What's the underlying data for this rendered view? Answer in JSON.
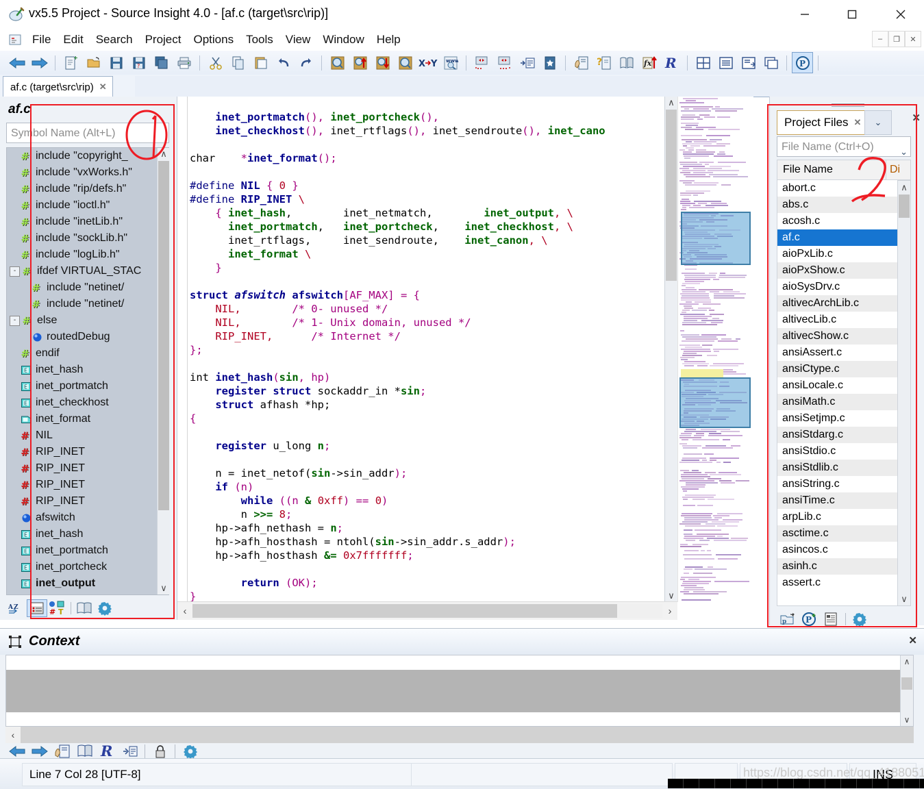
{
  "window": {
    "title": "vx5.5 Project - Source Insight 4.0 - [af.c (target\\src\\rip)]",
    "icon": "source-insight-icon",
    "minimize": "—",
    "maximize": "□",
    "close": "✕",
    "mdi_minimize": "–",
    "mdi_restore": "❐",
    "mdi_close": "✕"
  },
  "menu": {
    "items": [
      "File",
      "Edit",
      "Search",
      "Project",
      "Options",
      "Tools",
      "View",
      "Window",
      "Help"
    ]
  },
  "toolbar": {
    "groups": [
      [
        "back-arrow-icon",
        "forward-arrow-icon"
      ],
      [
        "new-file-icon",
        "open-folder-icon",
        "save-icon",
        "save-as-icon",
        "save-all-icon",
        "print-icon"
      ],
      [
        "cut-icon",
        "copy-icon",
        "paste-icon",
        "undo-icon",
        "redo-icon"
      ],
      [
        "search-icon",
        "search-up-icon",
        "search-down-icon",
        "search-files-icon",
        "replace-icon",
        "search-web-icon"
      ],
      [
        "indent-left-icon",
        "indent-right-icon",
        "format-list-icon",
        "bookmark-icon"
      ],
      [
        "clip-window-icon",
        "symbol-info-icon",
        "reference-icon",
        "function-jump-icon",
        "relation-window-icon"
      ],
      [
        "tile-icon",
        "window-list-icon",
        "panel-icon",
        "cascade-icon"
      ],
      [
        "project-icon"
      ]
    ]
  },
  "document_tab": {
    "label": "af.c (target\\src\\rip)",
    "close": "✕"
  },
  "symbol_panel": {
    "title": "af.c",
    "search_placeholder": "Symbol Name (Alt+L)",
    "search_value": "",
    "scroll_up": "∧",
    "scroll_down": "∨",
    "items": [
      {
        "label": "include \"copyright_",
        "icon": "preprocessor-green-icon",
        "indent": 1,
        "expander": "",
        "bold": false
      },
      {
        "label": "include \"vxWorks.h\"",
        "icon": "preprocessor-green-icon",
        "indent": 1,
        "expander": "",
        "bold": false
      },
      {
        "label": "include \"rip/defs.h\"",
        "icon": "preprocessor-green-icon",
        "indent": 1,
        "expander": "",
        "bold": false
      },
      {
        "label": "include \"ioctl.h\"",
        "icon": "preprocessor-green-icon",
        "indent": 1,
        "expander": "",
        "bold": false
      },
      {
        "label": "include \"inetLib.h\"",
        "icon": "preprocessor-green-icon",
        "indent": 1,
        "expander": "",
        "bold": false
      },
      {
        "label": "include \"sockLib.h\"",
        "icon": "preprocessor-green-icon",
        "indent": 1,
        "expander": "",
        "bold": false
      },
      {
        "label": "include \"logLib.h\"",
        "icon": "preprocessor-green-icon",
        "indent": 1,
        "expander": "",
        "bold": false
      },
      {
        "label": "ifdef VIRTUAL_STAC",
        "icon": "preprocessor-green-icon",
        "indent": 1,
        "expander": "-",
        "bold": false
      },
      {
        "label": "include \"netinet/",
        "icon": "preprocessor-green-icon",
        "indent": 2,
        "expander": "",
        "bold": false
      },
      {
        "label": "include \"netinet/",
        "icon": "preprocessor-green-icon",
        "indent": 2,
        "expander": "",
        "bold": false
      },
      {
        "label": "else",
        "icon": "preprocessor-green-icon",
        "indent": 1,
        "expander": "-",
        "bold": false
      },
      {
        "label": "routedDebug",
        "icon": "variable-blue-icon",
        "indent": 2,
        "expander": "",
        "bold": false
      },
      {
        "label": "endif",
        "icon": "preprocessor-green-icon",
        "indent": 1,
        "expander": "",
        "bold": false
      },
      {
        "label": "inet_hash",
        "icon": "function-decl-icon",
        "indent": 1,
        "expander": "",
        "bold": false
      },
      {
        "label": "inet_portmatch",
        "icon": "function-decl-icon",
        "indent": 1,
        "expander": "",
        "bold": false
      },
      {
        "label": "inet_checkhost",
        "icon": "function-decl-icon",
        "indent": 1,
        "expander": "",
        "bold": false
      },
      {
        "label": "inet_format",
        "icon": "function-proto-icon",
        "indent": 1,
        "expander": "",
        "bold": false
      },
      {
        "label": "NIL",
        "icon": "preprocessor-red-icon",
        "indent": 1,
        "expander": "",
        "bold": false
      },
      {
        "label": "RIP_INET",
        "icon": "preprocessor-red-icon",
        "indent": 1,
        "expander": "",
        "bold": false
      },
      {
        "label": "RIP_INET",
        "icon": "preprocessor-red-icon",
        "indent": 1,
        "expander": "",
        "bold": false
      },
      {
        "label": "RIP_INET",
        "icon": "preprocessor-red-icon",
        "indent": 1,
        "expander": "",
        "bold": false
      },
      {
        "label": "RIP_INET",
        "icon": "preprocessor-red-icon",
        "indent": 1,
        "expander": "",
        "bold": false
      },
      {
        "label": "afswitch",
        "icon": "variable-blue-icon",
        "indent": 1,
        "expander": "",
        "bold": false
      },
      {
        "label": "inet_hash",
        "icon": "function-decl-icon",
        "indent": 1,
        "expander": "",
        "bold": false
      },
      {
        "label": "inet_portmatch",
        "icon": "function-decl-icon",
        "indent": 1,
        "expander": "",
        "bold": false
      },
      {
        "label": "inet_portcheck",
        "icon": "function-decl-icon",
        "indent": 1,
        "expander": "",
        "bold": false
      },
      {
        "label": "inet_output",
        "icon": "function-decl-icon",
        "indent": 1,
        "expander": "",
        "bold": true
      }
    ],
    "toolbar_icons": [
      "sort-alpha-icon",
      "symbol-list-icon",
      "symbol-filter-icon",
      "browse-icon",
      "options-gear-icon"
    ]
  },
  "editor": {
    "lines": [
      [
        {
          "t": "    ",
          "c": "idp"
        },
        {
          "t": "inet_portmatch",
          "c": "fn"
        },
        {
          "t": "(),",
          "c": "pn"
        },
        {
          "t": " ",
          "c": "idp"
        },
        {
          "t": "inet_portcheck",
          "c": "id"
        },
        {
          "t": "(),",
          "c": "pn"
        }
      ],
      [
        {
          "t": "    ",
          "c": "idp"
        },
        {
          "t": "inet_checkhost",
          "c": "fn"
        },
        {
          "t": "(),",
          "c": "pn"
        },
        {
          "t": " inet_rtflags",
          "c": "idp"
        },
        {
          "t": "(),",
          "c": "pn"
        },
        {
          "t": " inet_sendroute",
          "c": "idp"
        },
        {
          "t": "(),",
          "c": "pn"
        },
        {
          "t": " ",
          "c": "idp"
        },
        {
          "t": "inet_cano",
          "c": "id"
        }
      ],
      [],
      [
        {
          "t": "char    ",
          "c": "idp"
        },
        {
          "t": "*",
          "c": "pn"
        },
        {
          "t": "inet_format",
          "c": "fn"
        },
        {
          "t": "();",
          "c": "pn"
        }
      ],
      [],
      [
        {
          "t": "#define ",
          "c": "pp"
        },
        {
          "t": "NIL",
          "c": "k"
        },
        {
          "t": " { ",
          "c": "pn"
        },
        {
          "t": "0",
          "c": "st"
        },
        {
          "t": " }",
          "c": "pn"
        }
      ],
      [
        {
          "t": "#define ",
          "c": "pp"
        },
        {
          "t": "RIP_INET",
          "c": "k"
        },
        {
          "t": " \\",
          "c": "mac"
        }
      ],
      [
        {
          "t": "    { ",
          "c": "pn"
        },
        {
          "t": "inet_hash",
          "c": "id"
        },
        {
          "t": ",        ",
          "c": "idp"
        },
        {
          "t": "inet_netmatch",
          "c": "idp"
        },
        {
          "t": ",        ",
          "c": "idp"
        },
        {
          "t": "inet_output",
          "c": "id"
        },
        {
          "t": ", \\",
          "c": "mac"
        }
      ],
      [
        {
          "t": "      ",
          "c": "idp"
        },
        {
          "t": "inet_portmatch",
          "c": "id"
        },
        {
          "t": ",   ",
          "c": "idp"
        },
        {
          "t": "inet_portcheck",
          "c": "id"
        },
        {
          "t": ",    ",
          "c": "idp"
        },
        {
          "t": "inet_checkhost",
          "c": "id"
        },
        {
          "t": ", \\",
          "c": "mac"
        }
      ],
      [
        {
          "t": "      inet_rtflags,     inet_sendroute,    ",
          "c": "idp"
        },
        {
          "t": "inet_canon",
          "c": "id"
        },
        {
          "t": ", \\",
          "c": "mac"
        }
      ],
      [
        {
          "t": "      ",
          "c": "idp"
        },
        {
          "t": "inet_format",
          "c": "id"
        },
        {
          "t": " \\",
          "c": "mac"
        }
      ],
      [
        {
          "t": "    }",
          "c": "pn"
        }
      ],
      [],
      [
        {
          "t": "struct ",
          "c": "k"
        },
        {
          "t": "afswitch",
          "c": "ty"
        },
        {
          "t": " ",
          "c": "idp"
        },
        {
          "t": "afswitch",
          "c": "k"
        },
        {
          "t": "[AF_MAX] = {",
          "c": "pn"
        }
      ],
      [
        {
          "t": "    ",
          "c": "idp"
        },
        {
          "t": "NIL,",
          "c": "mac"
        },
        {
          "t": "        ",
          "c": "idp"
        },
        {
          "t": "/* 0- unused */",
          "c": "cm"
        }
      ],
      [
        {
          "t": "    ",
          "c": "idp"
        },
        {
          "t": "NIL,",
          "c": "mac"
        },
        {
          "t": "        ",
          "c": "idp"
        },
        {
          "t": "/* 1- Unix domain, unused */",
          "c": "cm"
        }
      ],
      [
        {
          "t": "    ",
          "c": "idp"
        },
        {
          "t": "RIP_INET,",
          "c": "mac"
        },
        {
          "t": "      ",
          "c": "idp"
        },
        {
          "t": "/* Internet */",
          "c": "cm"
        }
      ],
      [
        {
          "t": "};",
          "c": "pn"
        }
      ],
      [],
      [
        {
          "t": "int ",
          "c": "idp"
        },
        {
          "t": "inet_hash",
          "c": "fn"
        },
        {
          "t": "(",
          "c": "pn"
        },
        {
          "t": "sin",
          "c": "id"
        },
        {
          "t": ", hp)",
          "c": "pn"
        }
      ],
      [
        {
          "t": "    ",
          "c": "idp"
        },
        {
          "t": "register struct",
          "c": "k"
        },
        {
          "t": " sockaddr_in *",
          "c": "idp"
        },
        {
          "t": "sin",
          "c": "id"
        },
        {
          "t": ";",
          "c": "pn"
        }
      ],
      [
        {
          "t": "    ",
          "c": "idp"
        },
        {
          "t": "struct",
          "c": "k"
        },
        {
          "t": " afhash *hp;",
          "c": "idp"
        }
      ],
      [
        {
          "t": "{",
          "c": "pn"
        }
      ],
      [],
      [
        {
          "t": "    ",
          "c": "idp"
        },
        {
          "t": "register",
          "c": "k"
        },
        {
          "t": " u_long ",
          "c": "idp"
        },
        {
          "t": "n",
          "c": "id"
        },
        {
          "t": ";",
          "c": "pn"
        }
      ],
      [],
      [
        {
          "t": "    n = inet_netof(",
          "c": "idp"
        },
        {
          "t": "sin",
          "c": "id"
        },
        {
          "t": "->sin_addr",
          "c": "idp"
        },
        {
          "t": ");",
          "c": "pn"
        }
      ],
      [
        {
          "t": "    ",
          "c": "idp"
        },
        {
          "t": "if",
          "c": "k"
        },
        {
          "t": " (n)",
          "c": "pn"
        }
      ],
      [
        {
          "t": "        ",
          "c": "idp"
        },
        {
          "t": "while",
          "c": "k"
        },
        {
          "t": " ((n ",
          "c": "pn"
        },
        {
          "t": "&",
          "c": "id"
        },
        {
          "t": " ",
          "c": "idp"
        },
        {
          "t": "0xff",
          "c": "st"
        },
        {
          "t": ") == ",
          "c": "pn"
        },
        {
          "t": "0",
          "c": "st"
        },
        {
          "t": ")",
          "c": "pn"
        }
      ],
      [
        {
          "t": "        n ",
          "c": "idp"
        },
        {
          "t": ">>=",
          "c": "id"
        },
        {
          "t": " ",
          "c": "idp"
        },
        {
          "t": "8",
          "c": "st"
        },
        {
          "t": ";",
          "c": "pn"
        }
      ],
      [
        {
          "t": "    hp->afh_nethash = ",
          "c": "idp"
        },
        {
          "t": "n",
          "c": "id"
        },
        {
          "t": ";",
          "c": "pn"
        }
      ],
      [
        {
          "t": "    hp->afh_hosthash = ntohl(",
          "c": "idp"
        },
        {
          "t": "sin",
          "c": "id"
        },
        {
          "t": "->sin_addr.s_addr",
          "c": "idp"
        },
        {
          "t": ");",
          "c": "pn"
        }
      ],
      [
        {
          "t": "    hp->afh_hosthash ",
          "c": "idp"
        },
        {
          "t": "&=",
          "c": "id"
        },
        {
          "t": " ",
          "c": "idp"
        },
        {
          "t": "0x7fffffff",
          "c": "st"
        },
        {
          "t": ";",
          "c": "pn"
        }
      ],
      [],
      [
        {
          "t": "        ",
          "c": "idp"
        },
        {
          "t": "return",
          "c": "k"
        },
        {
          "t": " (OK)",
          "c": "pn"
        },
        {
          "t": ";",
          "c": "pn"
        }
      ],
      [
        {
          "t": "}",
          "c": "pn"
        }
      ]
    ],
    "hscroll_left": "‹",
    "hscroll_right": "›",
    "vscroll_up": "∧",
    "vscroll_down": "∨"
  },
  "project_panel": {
    "tab_label": "Project Files",
    "tab_close": "✕",
    "tab_chevron": "⌄",
    "panel_close": "✕",
    "filter_placeholder": "File Name (Ctrl+O)",
    "filter_value": "",
    "filter_chevron": "⌄",
    "columns": [
      "File Name",
      "Di"
    ],
    "scroll_up": "∧",
    "scroll_down": "∨",
    "selected_file": "af.c",
    "files": [
      "abort.c",
      "abs.c",
      "acosh.c",
      "af.c",
      "aioPxLib.c",
      "aioPxShow.c",
      "aioSysDrv.c",
      "altivecArchLib.c",
      "altivecLib.c",
      "altivecShow.c",
      "ansiAssert.c",
      "ansiCtype.c",
      "ansiLocale.c",
      "ansiMath.c",
      "ansiSetjmp.c",
      "ansiStdarg.c",
      "ansiStdio.c",
      "ansiStdlib.c",
      "ansiString.c",
      "ansiTime.c",
      "arpLib.c",
      "asctime.c",
      "asincos.c",
      "asinh.c",
      "assert.c"
    ],
    "toolbar_icons": [
      "open-project-icon",
      "new-project-icon",
      "project-report-icon",
      "project-settings-gear-icon"
    ]
  },
  "context_panel": {
    "title": "Context",
    "icon": "context-window-icon",
    "close": "✕",
    "content": "",
    "hscroll_left": "‹",
    "scroll_up": "∧",
    "scroll_down": "∨",
    "toolbar_icons": [
      "back-arrow-icon",
      "forward-arrow-icon",
      "clip-icon",
      "reference-icon",
      "relation-icon",
      "outline-icon",
      "lock-icon",
      "options-gear-icon"
    ]
  },
  "status_bar": {
    "position": "Line 7  Col 28   [UTF-8]",
    "insert_mode": "INS",
    "middle": "",
    "cell_a": "",
    "cell_b": ""
  },
  "watermark": "https://blog.csdn.net/qq_41880511",
  "annotations": {
    "box_symbol_panel": "red-rect-annotation",
    "circle_symbol_search": "red-circle-annotation",
    "marker_one": "1",
    "box_project_panel": "red-rect-annotation",
    "marker_two": "2"
  },
  "colors": {
    "accent_blue": "#1675d1",
    "annotation_red": "#ee1c24",
    "panel_bg": "#eef2f7",
    "list_bg": "#c3cbd6",
    "tab_orange_border": "#c8a45a"
  }
}
